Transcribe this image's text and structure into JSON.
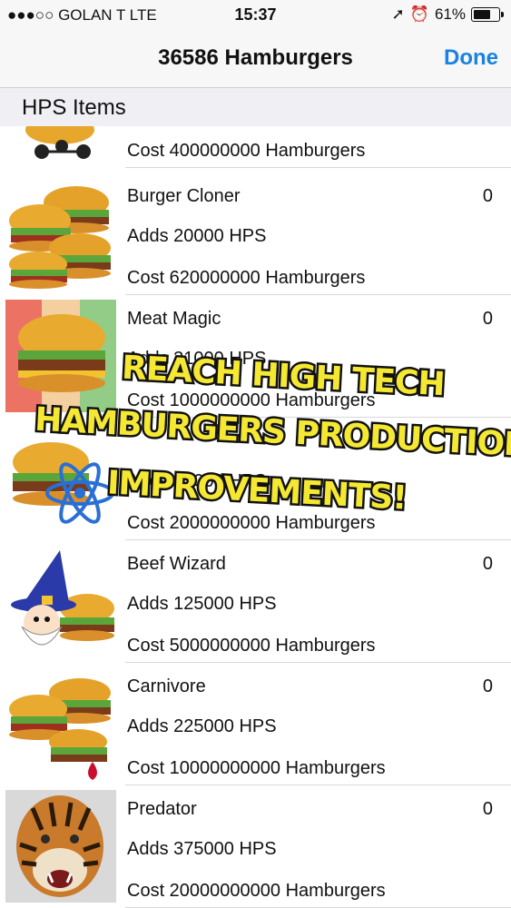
{
  "status": {
    "signal": "●●●○○ GOLAN T  LTE",
    "time": "15:37",
    "battery": "61%"
  },
  "nav": {
    "title": "36586 Hamburgers",
    "done": "Done"
  },
  "section": {
    "title": "HPS Items"
  },
  "items": [
    {
      "name": "",
      "adds": "",
      "cost": "Cost 400000000 Hamburgers",
      "count": "",
      "icon": "robot-burger-icon"
    },
    {
      "name": "Burger Cloner",
      "adds": "Adds 20000 HPS",
      "cost": "Cost 620000000 Hamburgers",
      "count": "0",
      "icon": "burger-stack-icon"
    },
    {
      "name": "Meat Magic",
      "adds": "Adds 31000 HPS",
      "cost": "Cost 1000000000 Hamburgers",
      "count": "0",
      "icon": "magic-burger-icon"
    },
    {
      "name": "",
      "adds": "Adds 82000 HPS",
      "cost": "Cost 2000000000 Hamburgers",
      "count": "0",
      "icon": "atom-burger-icon"
    },
    {
      "name": "Beef Wizard",
      "adds": "Adds 125000 HPS",
      "cost": "Cost 5000000000 Hamburgers",
      "count": "0",
      "icon": "wizard-burger-icon"
    },
    {
      "name": "Carnivore",
      "adds": "Adds 225000 HPS",
      "cost": "Cost 10000000000 Hamburgers",
      "count": "0",
      "icon": "carnivore-burger-icon"
    },
    {
      "name": "Predator",
      "adds": "Adds 375000 HPS",
      "cost": "Cost 20000000000 Hamburgers",
      "count": "0",
      "icon": "tiger-icon"
    }
  ],
  "promo": {
    "line1": "REACH HIGH TECH",
    "line2": "HAMBURGERS PRODUCTION",
    "line3": "IMPROVEMENTS!"
  }
}
